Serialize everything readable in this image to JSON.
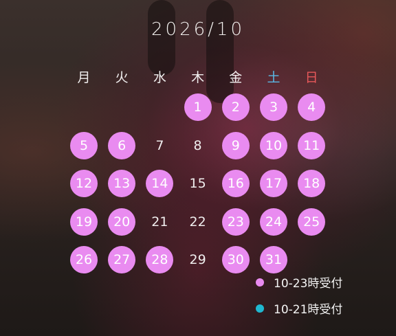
{
  "calendar": {
    "title": "2026/10",
    "weekdays": [
      {
        "label": "月",
        "color": "#f0eeee"
      },
      {
        "label": "火",
        "color": "#f0eeee"
      },
      {
        "label": "水",
        "color": "#f0eeee"
      },
      {
        "label": "木",
        "color": "#f0eeee"
      },
      {
        "label": "金",
        "color": "#f0eeee"
      },
      {
        "label": "土",
        "color": "#5ab8e6"
      },
      {
        "label": "日",
        "color": "#e8585a"
      }
    ],
    "days": [
      {
        "day": "1",
        "status": "10-23"
      },
      {
        "day": "2",
        "status": "10-23"
      },
      {
        "day": "3",
        "status": "10-23"
      },
      {
        "day": "4",
        "status": "10-23"
      },
      {
        "day": "5",
        "status": "10-23"
      },
      {
        "day": "6",
        "status": "10-23"
      },
      {
        "day": "7",
        "status": "none"
      },
      {
        "day": "8",
        "status": "none"
      },
      {
        "day": "9",
        "status": "10-23"
      },
      {
        "day": "10",
        "status": "10-23"
      },
      {
        "day": "11",
        "status": "10-23"
      },
      {
        "day": "12",
        "status": "10-23"
      },
      {
        "day": "13",
        "status": "10-23"
      },
      {
        "day": "14",
        "status": "10-23"
      },
      {
        "day": "15",
        "status": "none"
      },
      {
        "day": "16",
        "status": "10-23"
      },
      {
        "day": "17",
        "status": "10-23"
      },
      {
        "day": "18",
        "status": "10-23"
      },
      {
        "day": "19",
        "status": "10-23"
      },
      {
        "day": "20",
        "status": "10-23"
      },
      {
        "day": "21",
        "status": "none"
      },
      {
        "day": "22",
        "status": "none"
      },
      {
        "day": "23",
        "status": "10-23"
      },
      {
        "day": "24",
        "status": "10-23"
      },
      {
        "day": "25",
        "status": "10-23"
      },
      {
        "day": "26",
        "status": "10-23"
      },
      {
        "day": "27",
        "status": "10-23"
      },
      {
        "day": "28",
        "status": "10-23"
      },
      {
        "day": "29",
        "status": "none"
      },
      {
        "day": "30",
        "status": "10-23"
      },
      {
        "day": "31",
        "status": "10-23"
      }
    ],
    "first_weekday_index": 3
  },
  "legend": [
    {
      "label": "10-23時受付",
      "color": "#e98bf0"
    },
    {
      "label": "10-21時受付",
      "color": "#1fb8d0"
    }
  ]
}
